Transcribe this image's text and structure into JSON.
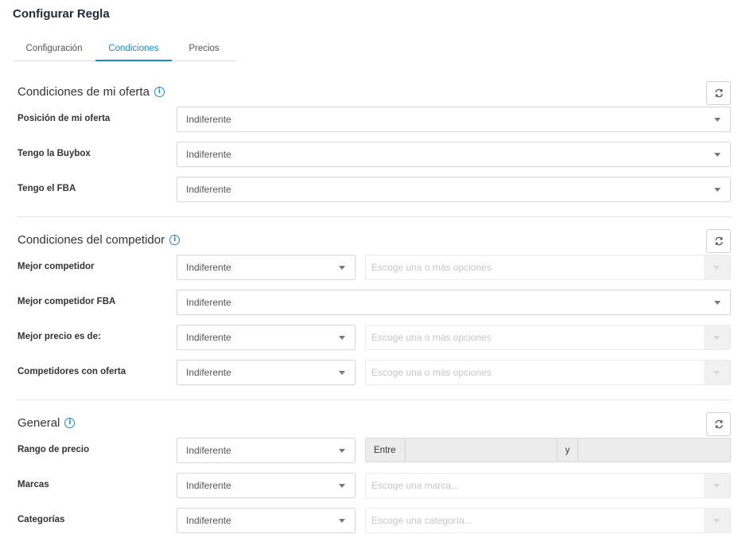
{
  "page": {
    "title": "Configurar Regla"
  },
  "tabs": [
    {
      "label": "Configuración",
      "active": false
    },
    {
      "label": "Condiciones",
      "active": true
    },
    {
      "label": "Precios",
      "active": false
    }
  ],
  "colors": {
    "accent": "#1e88c9",
    "text": "#333333",
    "border": "#d8d8d8",
    "disabled_bg": "#f1f1f1"
  },
  "sections": {
    "mi_oferta": {
      "title": "Condiciones de mi oferta",
      "rows": [
        {
          "label": "Posición de mi oferta",
          "value": "Indiferente"
        },
        {
          "label": "Tengo la Buybox",
          "value": "Indiferente"
        },
        {
          "label": "Tengo el FBA",
          "value": "Indiferente"
        }
      ]
    },
    "competidor": {
      "title": "Condiciones del competidor",
      "rows": [
        {
          "label": "Mejor competidor",
          "value": "Indiferente",
          "placeholder": "Escoge una o más opciones"
        },
        {
          "label": "Mejor competidor FBA",
          "value": "Indiferente"
        },
        {
          "label": "Mejor precio es de:",
          "value": "Indiferente",
          "placeholder": "Escoge una o más opciones"
        },
        {
          "label": "Competidores con oferta",
          "value": "Indiferente",
          "placeholder": "Escoge una o más opciones"
        }
      ]
    },
    "general": {
      "title": "General",
      "rows": [
        {
          "label": "Rango de precio",
          "value": "Indiferente",
          "range_from": "Entre",
          "range_to": "y"
        },
        {
          "label": "Marcas",
          "value": "Indiferente",
          "placeholder": "Escoge una marca..."
        },
        {
          "label": "Categorías",
          "value": "Indiferente",
          "placeholder": "Escoge una categoría..."
        }
      ]
    }
  },
  "icons": {
    "info": "info-circle-icon",
    "refresh": "refresh-icon",
    "dropdown": "caret-down-icon"
  }
}
